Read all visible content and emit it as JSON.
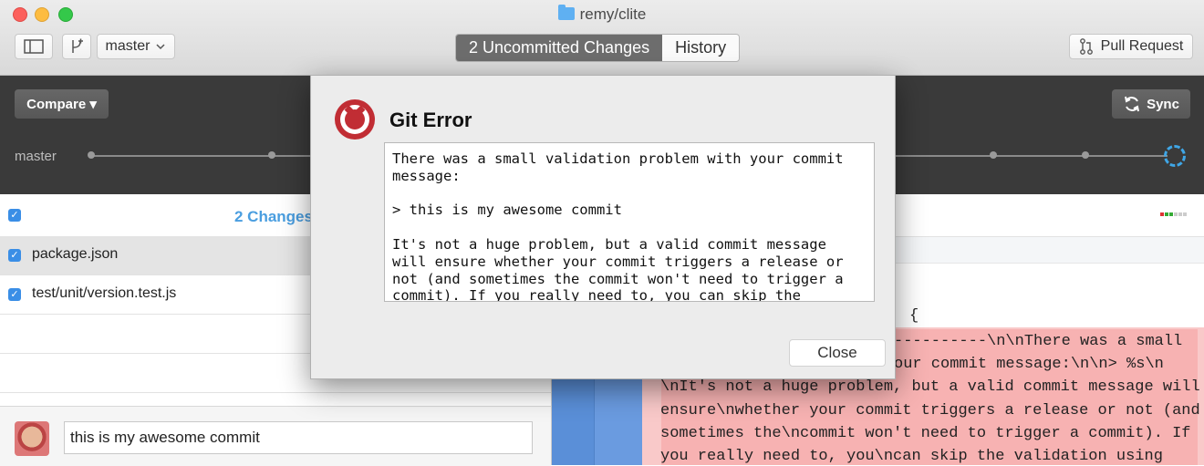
{
  "window": {
    "title": "remy/clite"
  },
  "toolbar": {
    "branch": "master",
    "tabs": [
      {
        "label": "2 Uncommitted Changes",
        "active": true
      },
      {
        "label": "History",
        "active": false
      }
    ],
    "pull_request_label": "Pull Request"
  },
  "compare_bar": {
    "compare_label": "Compare ▾",
    "sync_label": "Sync",
    "branch_label": "master"
  },
  "changes": {
    "header": "2 Changes",
    "files": [
      {
        "name": "package.json",
        "checked": true
      },
      {
        "name": "test/unit/version.test.js",
        "checked": true
      }
    ]
  },
  "commit": {
    "summary_value": "this is my awesome commit"
  },
  "diff": {
    "lines": [
      "{",
      "----------\\n\\nThere was a small",
      "our commit message:\\n\\n> %s\\n",
      "\\nIt's not a huge problem, but a valid commit message will",
      "ensure\\nwhether your commit triggers a release or not (and",
      "sometimes the\\ncommit won't need to trigger a commit). If",
      "you really need to, you\\ncan skip the validation using"
    ]
  },
  "dialog": {
    "title": "Git Error",
    "message": "There was a small validation problem with your commit\nmessage:\n\n> this is my awesome commit\n\nIt's not a huge problem, but a valid commit message\nwill ensure whether your commit triggers a release or\nnot (and sometimes the commit won't need to trigger a\ncommit). If you really need to, you can skip the",
    "close_label": "Close"
  },
  "colors": {
    "accent": "#4a9ee0",
    "error_icon": "#c12d34",
    "diff_removed": "#f9c9c9",
    "gutter": "#5a8fd8"
  }
}
